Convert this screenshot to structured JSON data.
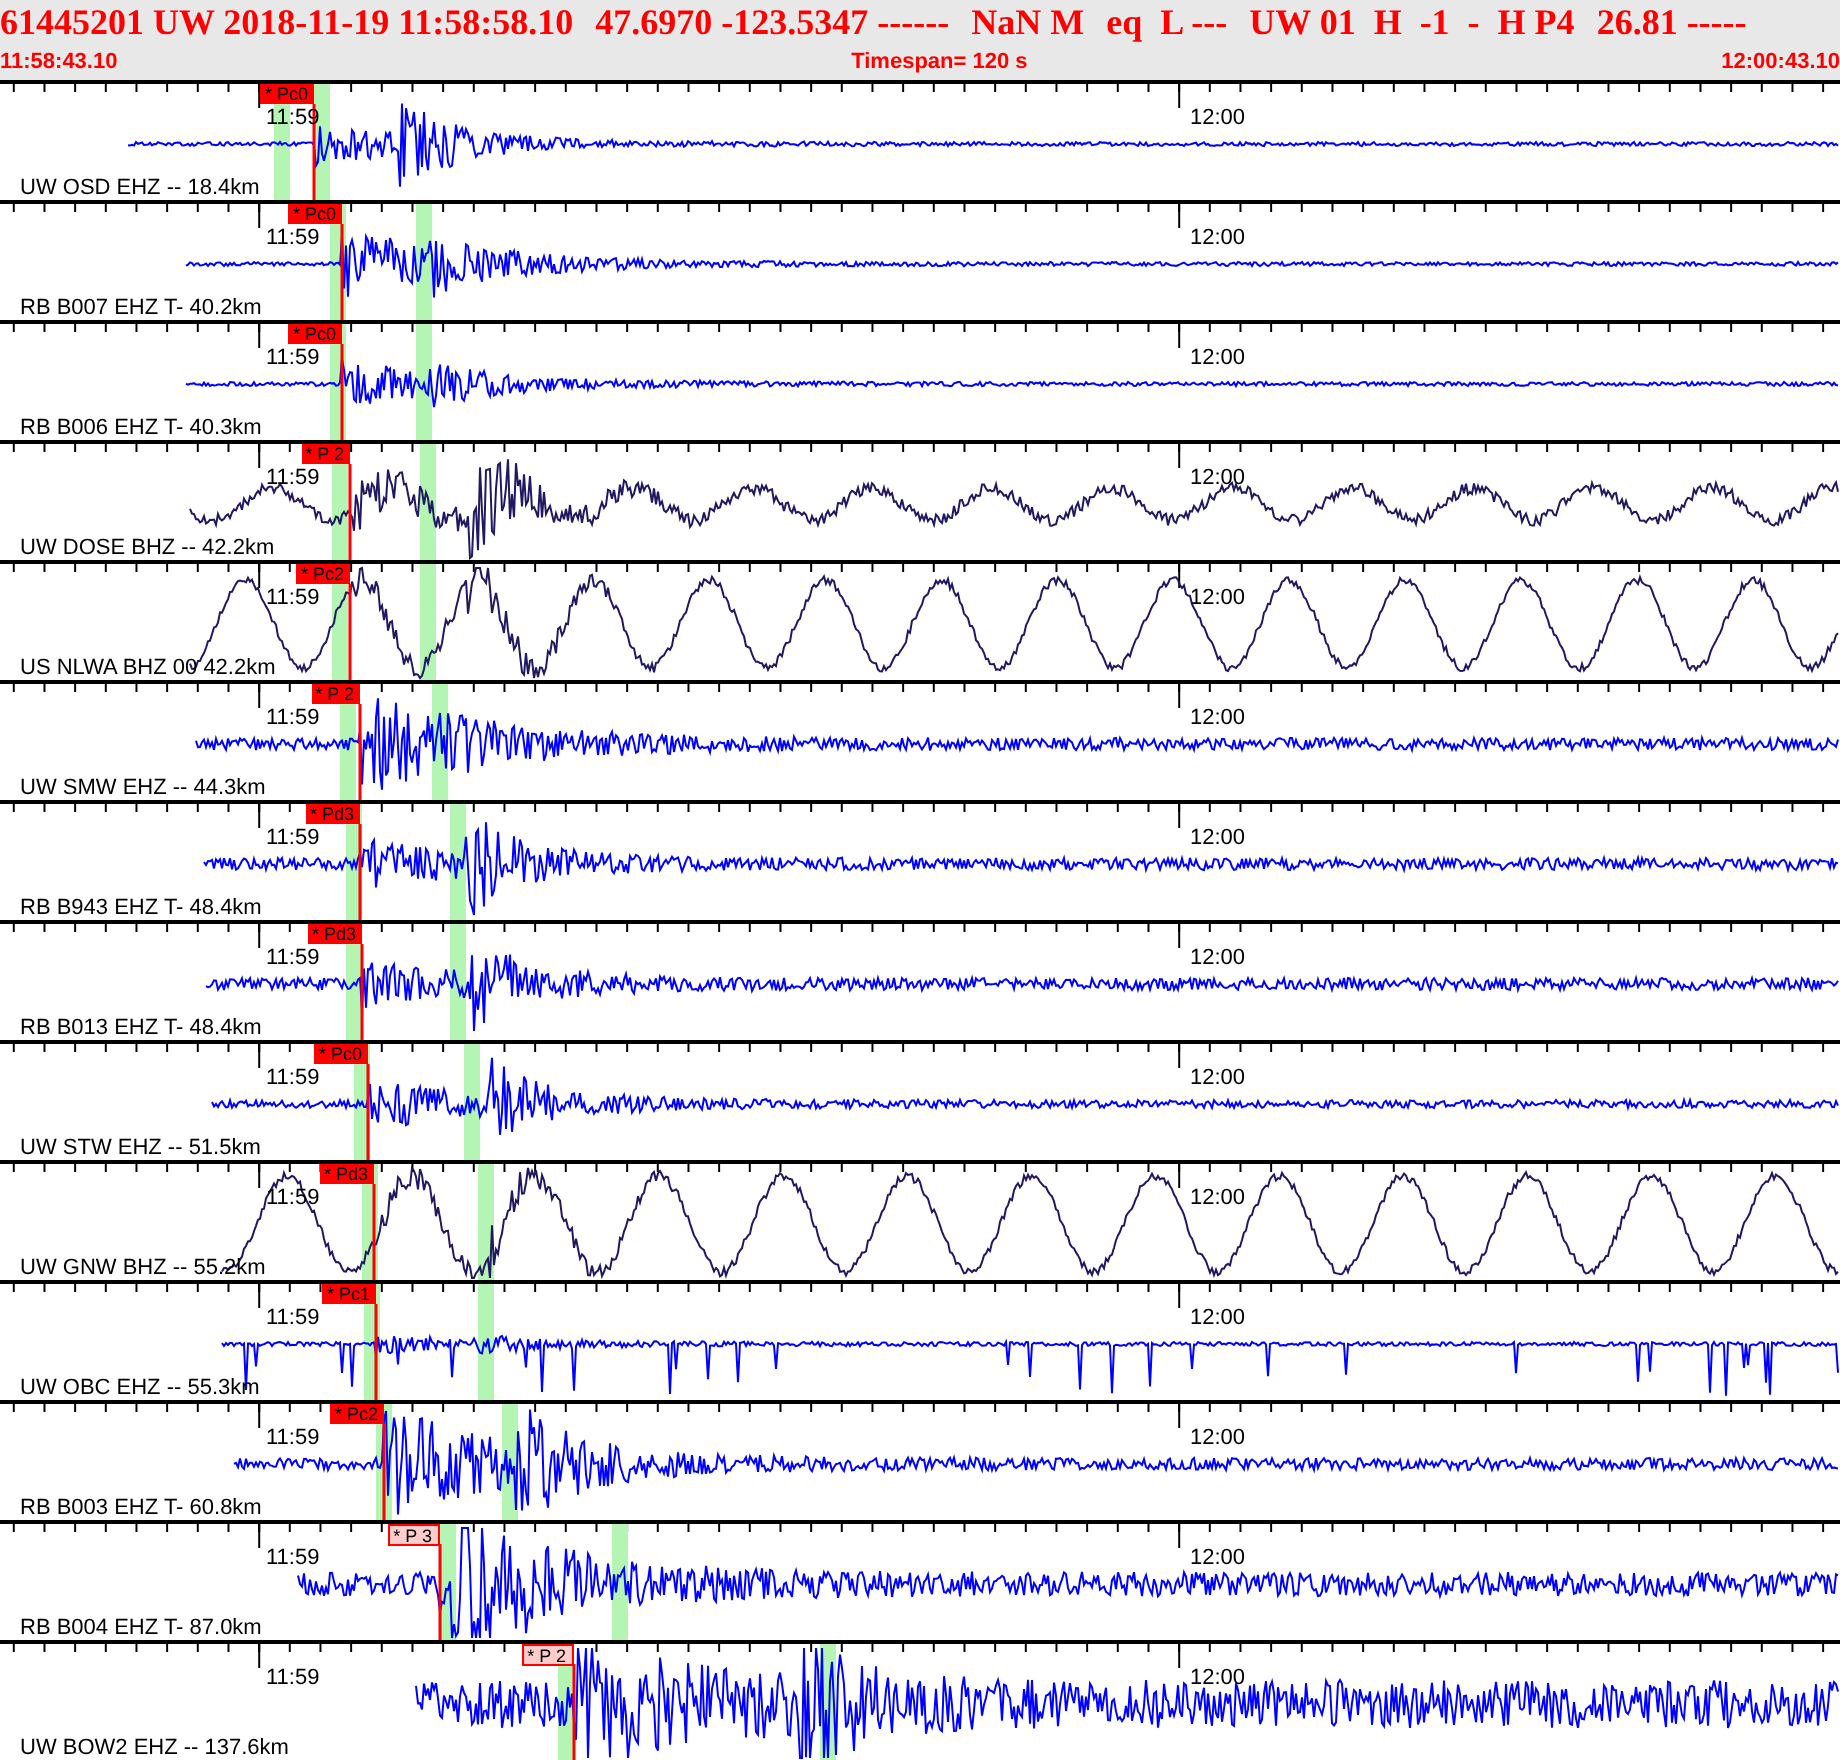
{
  "header": {
    "title_segments": [
      "61445201 UW 2018-11-19 11:58:58.10",
      "47.6970 -123.5347 ------",
      "NaN M",
      "eq  L ---",
      "UW 01  H  -1  -  H P4",
      "26.81 -----"
    ],
    "start_time": "11:58:43.10",
    "timespan": "Timespan= 120 s",
    "end_time": "12:00:43.10"
  },
  "channels": [
    {
      "label": "UW OSD EHZ -- 18.4km",
      "kind": "short",
      "color": "#0000ff",
      "time_left": "11:59",
      "time_right": "12:00",
      "pick": {
        "label": "* Pc0",
        "kind": "solid"
      }
    },
    {
      "label": "RB B007 EHZ T- 40.2km",
      "kind": "short",
      "color": "#0000ff",
      "time_left": "11:59",
      "time_right": "12:00",
      "pick": {
        "label": "* Pc0",
        "kind": "solid"
      }
    },
    {
      "label": "RB B006 EHZ T- 40.3km",
      "kind": "short",
      "color": "#0000ff",
      "time_left": "11:59",
      "time_right": "12:00",
      "pick": {
        "label": "* Pc0",
        "kind": "solid"
      }
    },
    {
      "label": "UW DOSE BHZ -- 42.2km",
      "kind": "long",
      "color": "#201860",
      "time_left": "11:59",
      "time_right": "12:00",
      "pick": {
        "label": "* P 2",
        "kind": "solid"
      }
    },
    {
      "label": "US NLWA BHZ 00 42.2km",
      "kind": "long",
      "color": "#201860",
      "time_left": "11:59",
      "time_right": "12:00",
      "pick": {
        "label": "* Pc2",
        "kind": "solid"
      }
    },
    {
      "label": "UW SMW EHZ -- 44.3km",
      "kind": "short",
      "color": "#0000ff",
      "time_left": "11:59",
      "time_right": "12:00",
      "pick": {
        "label": "* P 2",
        "kind": "solid"
      }
    },
    {
      "label": "RB B943 EHZ T- 48.4km",
      "kind": "short",
      "color": "#0000ff",
      "time_left": "11:59",
      "time_right": "12:00",
      "pick": {
        "label": "* Pd3",
        "kind": "solid"
      }
    },
    {
      "label": "RB B013 EHZ T- 48.4km",
      "kind": "short",
      "color": "#0000ff",
      "time_left": "11:59",
      "time_right": "12:00",
      "pick": {
        "label": "* Pd3",
        "kind": "solid"
      }
    },
    {
      "label": "UW STW EHZ -- 51.5km",
      "kind": "short",
      "color": "#0000ff",
      "time_left": "11:59",
      "time_right": "12:00",
      "pick": {
        "label": "* Pc0",
        "kind": "solid"
      }
    },
    {
      "label": "UW GNW BHZ -- 55.2km",
      "kind": "long",
      "color": "#201860",
      "time_left": "11:59",
      "time_right": "12:00",
      "pick": {
        "label": "* Pd3",
        "kind": "solid"
      }
    },
    {
      "label": "UW OBC EHZ -- 55.3km",
      "kind": "spiky",
      "color": "#0000ff",
      "time_left": "11:59",
      "time_right": "12:00",
      "pick": {
        "label": "* Pc1",
        "kind": "solid"
      }
    },
    {
      "label": "RB B003 EHZ T- 60.8km",
      "kind": "short",
      "color": "#0000ff",
      "time_left": "11:59",
      "time_right": "12:00",
      "pick": {
        "label": "* Pc2",
        "kind": "solid"
      }
    },
    {
      "label": "RB B004 EHZ T- 87.0km",
      "kind": "short",
      "color": "#0000ff",
      "time_left": "11:59",
      "time_right": "12:00",
      "pick": {
        "label": "* P 3",
        "kind": "light"
      }
    },
    {
      "label": "UW BOW2 EHZ -- 137.6km",
      "kind": "short",
      "color": "#0000ff",
      "time_left": "11:59",
      "time_right": "12:00",
      "pick": {
        "label": "* P 2",
        "kind": "light"
      }
    }
  ]
}
